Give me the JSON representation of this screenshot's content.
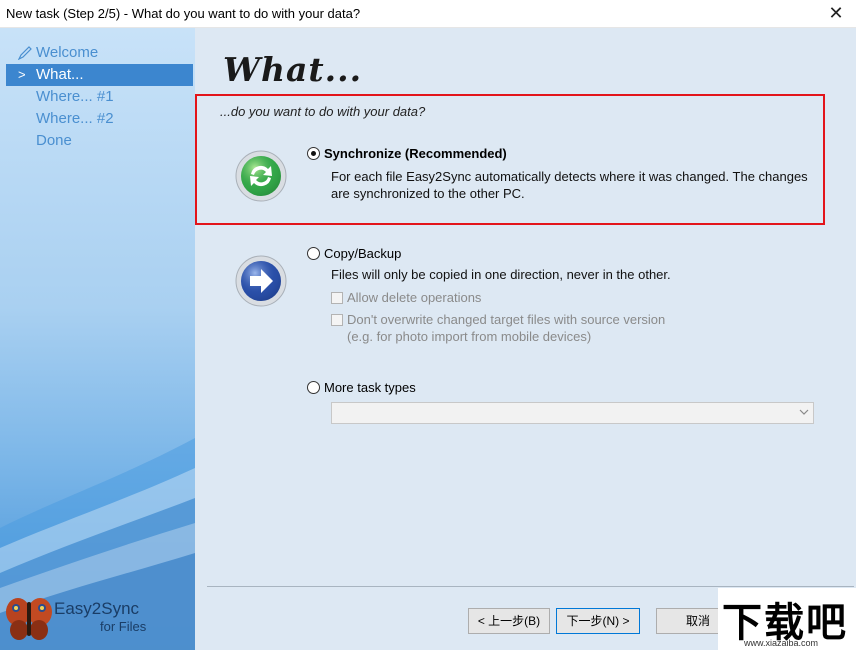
{
  "window": {
    "title": "New task (Step 2/5) - What do you want to do with your data?",
    "close_glyph": "✕"
  },
  "sidebar": {
    "items": [
      {
        "label": "Welcome",
        "icon": "pencil-icon"
      },
      {
        "label": "What...",
        "marker": ">",
        "active": true
      },
      {
        "label": "Where... #1"
      },
      {
        "label": "Where... #2"
      },
      {
        "label": "Done"
      }
    ],
    "brand_name": "Easy2Sync",
    "brand_sub": "for Files"
  },
  "main": {
    "heading": "What...",
    "subheading": "...do you want to do with your data?",
    "options": [
      {
        "label": "Synchronize (Recommended)",
        "checked": true,
        "description": "For each file Easy2Sync automatically detects where it was changed. The changes are synchronized to the other PC.",
        "icon": "sync-icon"
      },
      {
        "label": "Copy/Backup",
        "checked": false,
        "description": "Files will only be copied in one direction, never in the other.",
        "icon": "arrow-right-icon",
        "checks": [
          {
            "label": "Allow delete operations"
          },
          {
            "label": "Don't overwrite changed target files with source version",
            "note": "(e.g. for photo import from mobile devices)"
          }
        ]
      },
      {
        "label": "More task types",
        "checked": false
      }
    ],
    "task_type_select_value": ""
  },
  "footer": {
    "back_label": "< 上一步(B)",
    "next_label": "下一步(N) >",
    "cancel_label": "取消"
  },
  "watermark": {
    "big": "下载吧",
    "small": "www.xiazaiba.com"
  },
  "colors": {
    "highlight": "#e3141a",
    "nav_active_bg": "#3c86cf",
    "nav_text": "#4a8fd0",
    "content_bg": "#dde8f3"
  }
}
